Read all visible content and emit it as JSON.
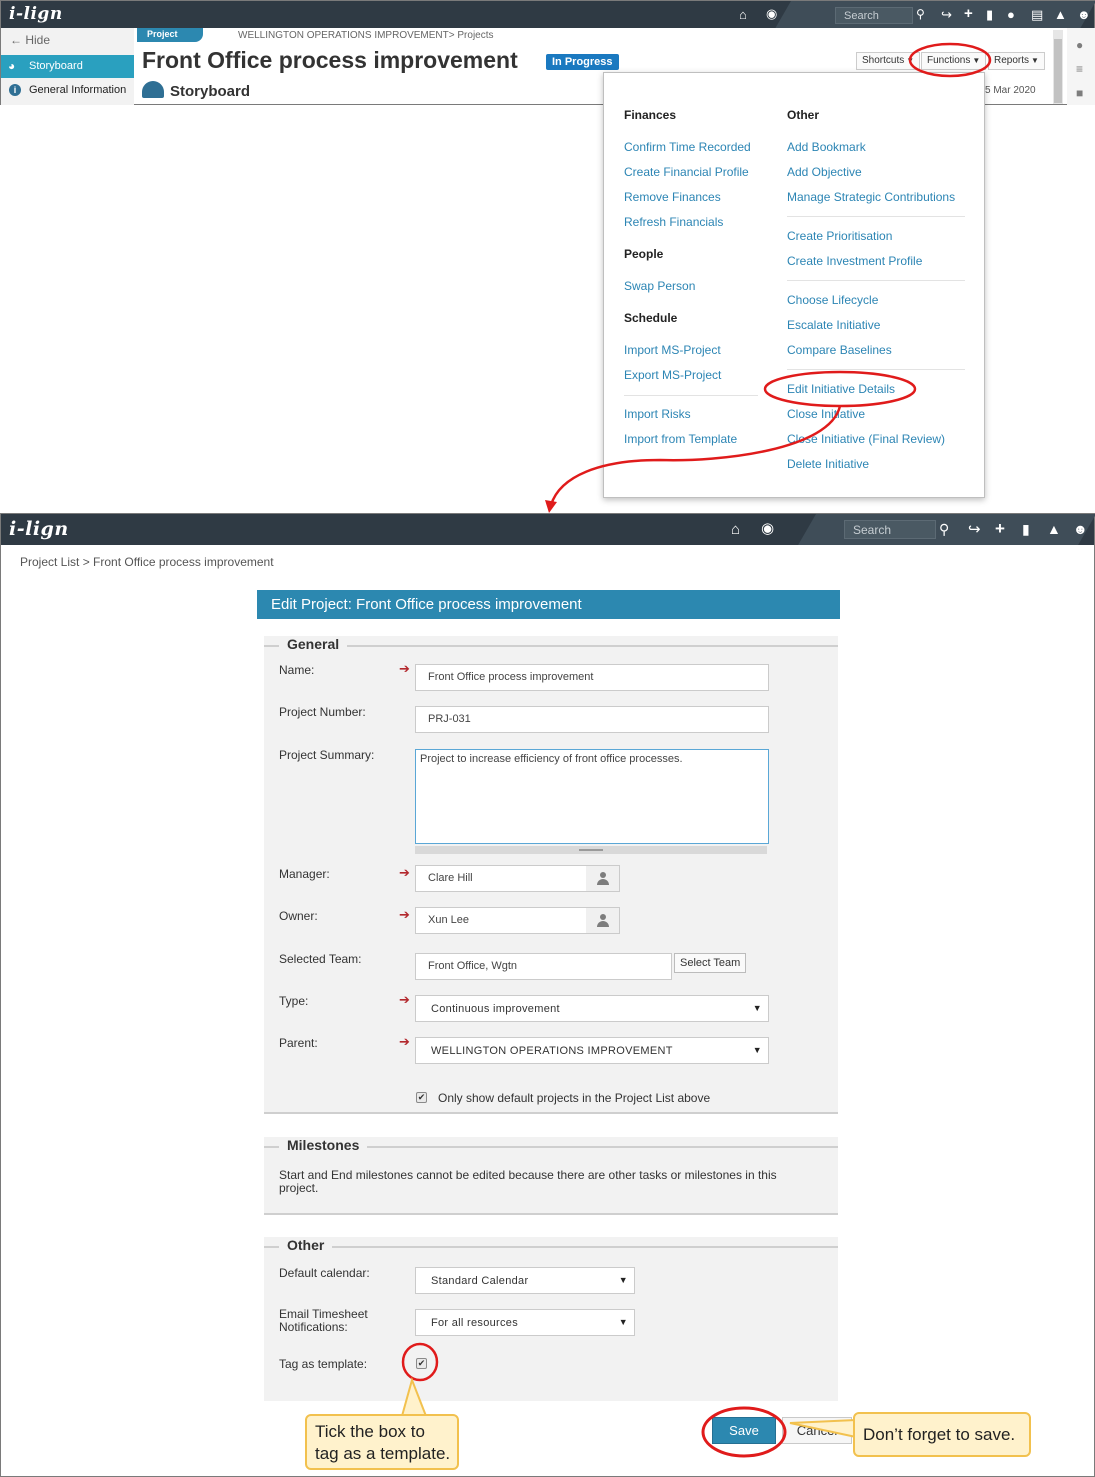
{
  "app": {
    "logo": "i-lign"
  },
  "top": {
    "search_placeholder": "Search",
    "sidebar": {
      "hide_label": "Hide",
      "storyboard_label": "Storyboard",
      "general_info_label": "General Information"
    },
    "project_tab": "Project",
    "breadcrumb": "WELLINGTON OPERATIONS IMPROVEMENT> Projects",
    "title": "Front Office process improvement",
    "status": "In Progress",
    "subtitle": "Storyboard",
    "toolbar": {
      "shortcuts": "Shortcuts",
      "functions": "Functions",
      "reports": "Reports"
    },
    "date_fragment": "5 Mar 2020"
  },
  "functions_menu": {
    "finances": {
      "heading": "Finances",
      "items": [
        "Confirm Time Recorded",
        "Create Financial Profile",
        "Remove Finances",
        "Refresh Financials"
      ]
    },
    "people": {
      "heading": "People",
      "items": [
        "Swap Person"
      ]
    },
    "schedule": {
      "heading": "Schedule",
      "items": [
        "Import MS-Project",
        "Export MS-Project"
      ]
    },
    "misc": {
      "items": [
        "Import Risks",
        "Import from Template"
      ]
    },
    "other": {
      "heading": "Other",
      "items": [
        "Add Bookmark",
        "Add Objective",
        "Manage Strategic Contributions",
        "Create Prioritisation",
        "Create Investment Profile",
        "Choose Lifecycle",
        "Escalate Initiative",
        "Compare Baselines",
        "Edit Initiative Details",
        "Close Initiative",
        "Close Initiative (Final Review)",
        "Delete Initiative"
      ]
    }
  },
  "edit": {
    "search_placeholder": "Search",
    "breadcrumb": "Project List > Front Office process improvement",
    "header": "Edit Project: Front Office process improvement",
    "general": {
      "title": "General",
      "name_label": "Name:",
      "name_value": "Front Office process improvement",
      "number_label": "Project Number:",
      "number_value": "PRJ-031",
      "summary_label": "Project Summary:",
      "summary_value": "Project to increase efficiency of front office processes.",
      "manager_label": "Manager:",
      "manager_value": "Clare Hill",
      "owner_label": "Owner:",
      "owner_value": "Xun Lee",
      "team_label": "Selected Team:",
      "team_value": "Front Office, Wgtn",
      "select_team_button": "Select Team",
      "type_label": "Type:",
      "type_value": "Continuous improvement",
      "parent_label": "Parent:",
      "parent_value": "WELLINGTON OPERATIONS IMPROVEMENT",
      "default_projects_label": "Only show default projects in the Project List above",
      "default_projects_checked": true
    },
    "milestones": {
      "title": "Milestones",
      "note": "Start and End milestones cannot be edited because there are other tasks or milestones in this project."
    },
    "other": {
      "title": "Other",
      "calendar_label": "Default calendar:",
      "calendar_value": "Standard Calendar",
      "email_label_1": "Email Timesheet",
      "email_label_2": "Notifications:",
      "email_value": "For all resources",
      "template_label": "Tag as template:",
      "template_checked": true
    },
    "save_label": "Save",
    "cancel_label": "Cancel"
  },
  "callouts": {
    "template_line1": "Tick the box to",
    "template_line2": "tag as a template.",
    "save": "Don’t forget to save."
  },
  "colors": {
    "accent": "#2c88b0",
    "link": "#2c85b4",
    "annotation": "#e01b1b",
    "callout_fill": "#fff2cc",
    "callout_border": "#f2c14e"
  }
}
